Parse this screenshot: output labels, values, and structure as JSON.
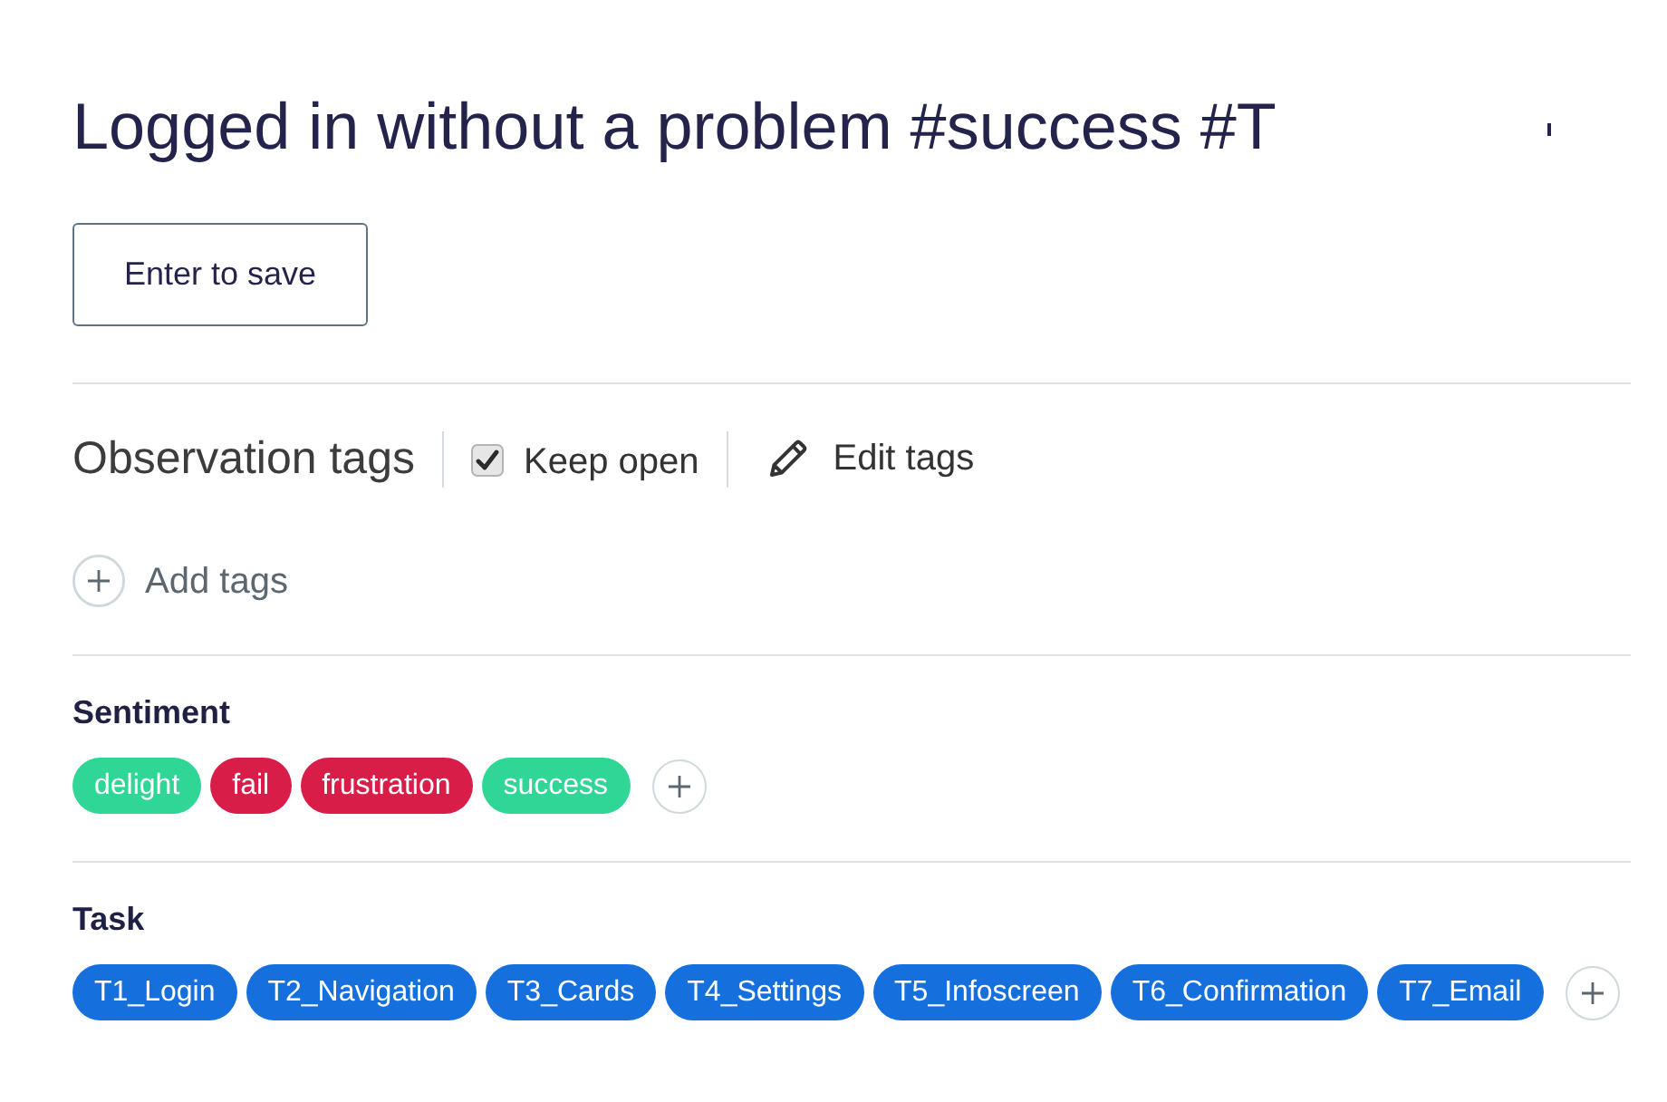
{
  "note": {
    "value": "Logged in without a problem #success #T"
  },
  "save_button": {
    "label": "Enter to save"
  },
  "observation_tags": {
    "title": "Observation tags",
    "keep_open": {
      "label": "Keep open",
      "checked": true
    },
    "edit_tags": {
      "label": "Edit tags"
    },
    "add_tags": {
      "label": "Add tags"
    }
  },
  "tag_groups": [
    {
      "title": "Sentiment",
      "tags": [
        {
          "label": "delight",
          "color": "#2fd695"
        },
        {
          "label": "fail",
          "color": "#d81d48"
        },
        {
          "label": "frustration",
          "color": "#d81d48"
        },
        {
          "label": "success",
          "color": "#2fd695"
        }
      ]
    },
    {
      "title": "Task",
      "tags": [
        {
          "label": "T1_Login",
          "color": "#1570de"
        },
        {
          "label": "T2_Navigation",
          "color": "#1570de"
        },
        {
          "label": "T3_Cards",
          "color": "#1570de"
        },
        {
          "label": "T4_Settings",
          "color": "#1570de"
        },
        {
          "label": "T5_Infoscreen",
          "color": "#1570de"
        },
        {
          "label": "T6_Confirmation",
          "color": "#1570de"
        },
        {
          "label": "T7_Email",
          "color": "#1570de"
        }
      ]
    }
  ]
}
